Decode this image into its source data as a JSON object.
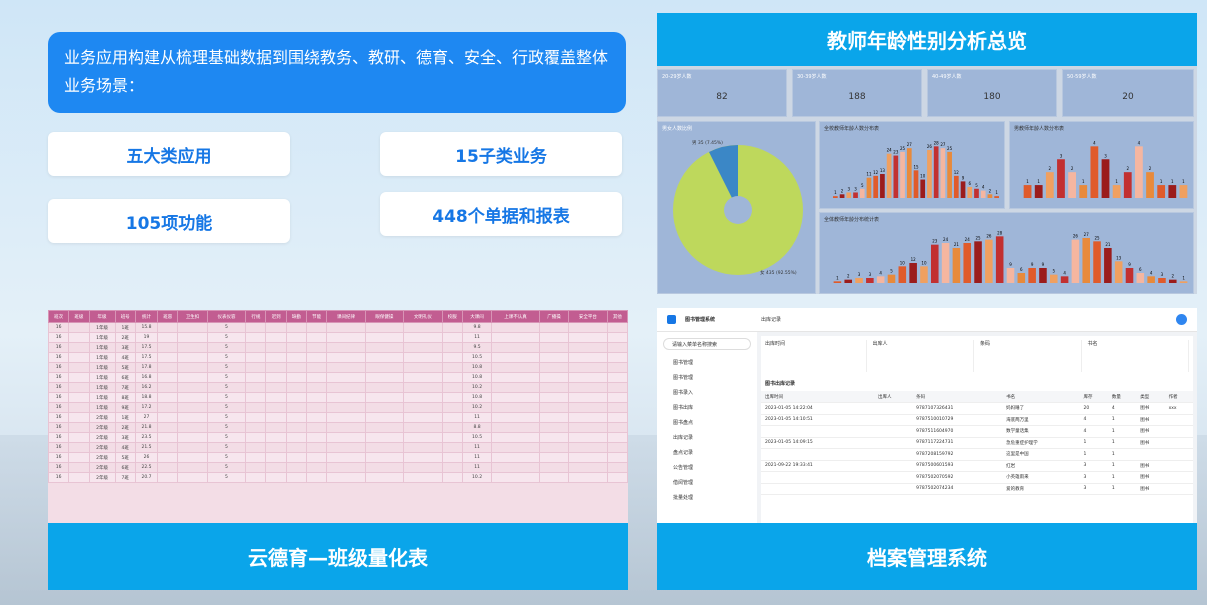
{
  "intro": "业务应用构建从梳理基础数据到围绕教务、教研、德育、安全、行政覆盖整体业务场景：",
  "stats": [
    "五大类应用",
    "15子类业务",
    "105项功能",
    "448个单据和报表"
  ],
  "panels": {
    "dashboard": "教师年龄性别分析总览",
    "table": "云德育—班级量化表",
    "archive": "档案管理系统"
  },
  "dash": {
    "cards": [
      {
        "label": "20-29岁人数",
        "value": "82"
      },
      {
        "label": "30-39岁人数",
        "value": "188"
      },
      {
        "label": "40-49岁人数",
        "value": "180"
      },
      {
        "label": "50-59岁人数",
        "value": "20"
      }
    ],
    "pie_title": "男女人数比例",
    "pie_small": "男 35 (7.45%)",
    "pie_big": "女 435 (92.55%)",
    "c1": "全校教师年龄人数分布表",
    "c2": "男教师年龄人数分布表",
    "c3": "全体教师年龄分布统计表"
  },
  "chart_data": [
    {
      "type": "bar",
      "title": "全校教师年龄人数分布表",
      "values": [
        1,
        2,
        3,
        3,
        5,
        11,
        12,
        13,
        24,
        23,
        25,
        27,
        15,
        10,
        26,
        28,
        27,
        25,
        12,
        9,
        6,
        5,
        4,
        2,
        1
      ]
    },
    {
      "type": "bar",
      "title": "男教师年龄人数分布表",
      "values": [
        1,
        1,
        2,
        3,
        2,
        1,
        4,
        3,
        1,
        2,
        4,
        2,
        1,
        1,
        1
      ]
    },
    {
      "type": "bar",
      "title": "全体教师年龄分布统计表",
      "values": [
        1,
        2,
        3,
        3,
        4,
        5,
        10,
        12,
        10,
        23,
        24,
        21,
        24,
        25,
        26,
        28,
        9,
        6,
        9,
        9,
        5,
        4,
        26,
        27,
        25,
        21,
        13,
        9,
        6,
        4,
        3,
        2,
        1
      ]
    }
  ],
  "table": {
    "headers": [
      "班次",
      "班级",
      "年级",
      "班号",
      "统计",
      "班容",
      "卫生扣",
      "仪表仪容",
      "行规",
      "迟到",
      "缺勤",
      "节能",
      "课间纪律",
      "眼保健操",
      "文明礼仪",
      "校服",
      "大课间",
      "上课不认真",
      "广播操",
      "安全平台",
      "其他"
    ],
    "rows": [
      [
        "16",
        "",
        "1年级",
        "1班",
        "15.8",
        "",
        "",
        "5",
        "",
        "",
        "",
        "",
        "",
        "",
        "",
        "",
        "9.8"
      ],
      [
        "16",
        "",
        "1年级",
        "2班",
        "19",
        "",
        "",
        "5",
        "",
        "",
        "",
        "",
        "",
        "",
        "",
        "",
        "11"
      ],
      [
        "16",
        "",
        "1年级",
        "3班",
        "17.5",
        "",
        "",
        "5",
        "",
        "",
        "",
        "",
        "",
        "",
        "",
        "",
        "9.5"
      ],
      [
        "16",
        "",
        "1年级",
        "4班",
        "17.5",
        "",
        "",
        "5",
        "",
        "",
        "",
        "",
        "",
        "",
        "",
        "",
        "10.5"
      ],
      [
        "16",
        "",
        "1年级",
        "5班",
        "17.8",
        "",
        "",
        "5",
        "",
        "",
        "",
        "",
        "",
        "",
        "",
        "",
        "10.8"
      ],
      [
        "16",
        "",
        "1年级",
        "6班",
        "16.8",
        "",
        "",
        "5",
        "",
        "",
        "",
        "",
        "",
        "",
        "",
        "",
        "10.8"
      ],
      [
        "16",
        "",
        "1年级",
        "7班",
        "16.2",
        "",
        "",
        "5",
        "",
        "",
        "",
        "",
        "",
        "",
        "",
        "",
        "10.2"
      ],
      [
        "16",
        "",
        "1年级",
        "8班",
        "18.8",
        "",
        "",
        "5",
        "",
        "",
        "",
        "",
        "",
        "",
        "",
        "",
        "10.8"
      ],
      [
        "16",
        "",
        "1年级",
        "9班",
        "17.2",
        "",
        "",
        "5",
        "",
        "",
        "",
        "",
        "",
        "",
        "",
        "",
        "10.2"
      ],
      [
        "16",
        "",
        "2年级",
        "1班",
        "27",
        "",
        "",
        "5",
        "",
        "",
        "",
        "",
        "",
        "",
        "",
        "",
        "11"
      ],
      [
        "16",
        "",
        "2年级",
        "2班",
        "21.8",
        "",
        "",
        "5",
        "",
        "",
        "",
        "",
        "",
        "",
        "",
        "",
        "8.8"
      ],
      [
        "16",
        "",
        "2年级",
        "3班",
        "23.5",
        "",
        "",
        "5",
        "",
        "",
        "",
        "",
        "",
        "",
        "",
        "",
        "10.5"
      ],
      [
        "16",
        "",
        "2年级",
        "4班",
        "21.5",
        "",
        "",
        "5",
        "",
        "",
        "",
        "",
        "",
        "",
        "",
        "",
        "11"
      ],
      [
        "16",
        "",
        "2年级",
        "5班",
        "26",
        "",
        "",
        "5",
        "",
        "",
        "",
        "",
        "",
        "",
        "",
        "",
        "11"
      ],
      [
        "16",
        "",
        "2年级",
        "6班",
        "22.5",
        "",
        "",
        "5",
        "",
        "",
        "",
        "",
        "",
        "",
        "",
        "",
        "11"
      ],
      [
        "16",
        "",
        "2年级",
        "7班",
        "20.7",
        "",
        "",
        "5",
        "",
        "",
        "",
        "",
        "",
        "",
        "",
        "",
        "10.2"
      ]
    ]
  },
  "lib": {
    "app": "图书管理系统",
    "page": "出库记录",
    "search": "请输入菜单名称搜索",
    "menu": [
      "图书管理",
      "图书管理",
      "图书录入",
      "图书出库",
      "图书盘点",
      "出库记录",
      "盘点记录",
      "公告管理",
      "借阅管理",
      "批量处理"
    ],
    "filters": [
      "出库时间",
      "出库人",
      "条码",
      "书名"
    ],
    "sub": "图书出库记录",
    "cols": [
      "出库时间",
      "出库人",
      "条码",
      "书名",
      "库存",
      "数量",
      "类型",
      "作者"
    ],
    "rows": [
      [
        "2023-01-05 14:22:04",
        "",
        "9787107326431",
        "妈妈睡了",
        "20",
        "4",
        "图书",
        "xxx"
      ],
      [
        "2023-01-05 14:10:51",
        "",
        "9787510010729",
        "海底两万里",
        "4",
        "1",
        "图书",
        ""
      ],
      [
        "",
        "",
        "9787511604970",
        "数学童话集",
        "4",
        "1",
        "图书",
        ""
      ],
      [
        "2023-01-05 14:09:15",
        "",
        "9787117224731",
        "急危重症护理学",
        "1",
        "1",
        "图书",
        ""
      ],
      [
        "",
        "",
        "9787208159792",
        "这里是中国",
        "1",
        "1",
        "",
        ""
      ],
      [
        "2021-09-22 19:33:41",
        "",
        "9787500601593",
        "红岩",
        "3",
        "1",
        "图书",
        ""
      ],
      [
        "",
        "",
        "9787502070592",
        "小英雄雨来",
        "3",
        "1",
        "图书",
        ""
      ],
      [
        "",
        "",
        "9787502074234",
        "爱的教育",
        "3",
        "1",
        "图书",
        ""
      ]
    ]
  }
}
